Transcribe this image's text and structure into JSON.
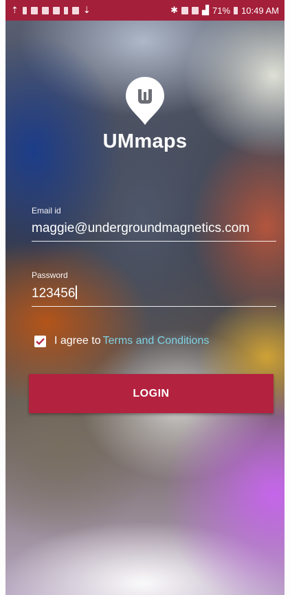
{
  "status_bar": {
    "battery": "71%",
    "time": "10:49 AM",
    "left_icons": [
      "upload-icon",
      "figure-icon",
      "image-icon",
      "card-icon",
      "image-icon",
      "lock-icon",
      "video-icon",
      "download-icon"
    ],
    "right_icons": [
      "bluetooth-icon",
      "nfc-icon",
      "lte-icon",
      "signal-icon",
      "battery-icon"
    ],
    "color": "#a41f3a"
  },
  "app": {
    "name": "UMmaps",
    "logo_icon": "map-pin-logo-icon"
  },
  "form": {
    "email": {
      "label": "Email id",
      "value": "maggie@undergroundmagnetics.com"
    },
    "password": {
      "label": "Password",
      "value": "123456"
    },
    "agree": {
      "checked": true,
      "prefix": "I agree to",
      "link": "Terms and Conditions"
    },
    "login_label": "LOGIN"
  },
  "colors": {
    "accent": "#b3223f",
    "link": "#7fd3e6"
  }
}
